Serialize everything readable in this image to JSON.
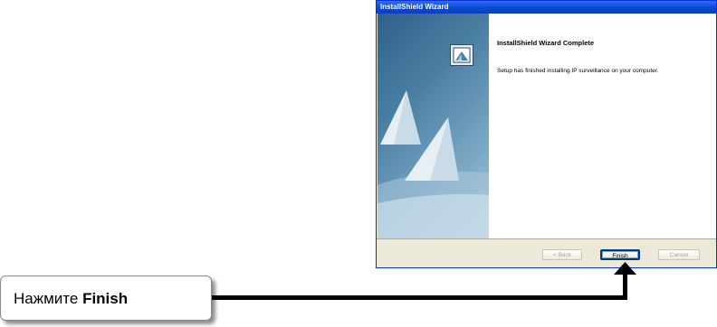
{
  "window": {
    "title": "InstallShield Wizard",
    "heading": "InstallShield Wizard Complete",
    "message": "Setup has finished installing IP surveillance on your computer."
  },
  "buttons": {
    "back": "< Back",
    "finish": "Finish",
    "cancel": "Cancel"
  },
  "callout": {
    "prefix": "Нажмите",
    "emphasis": "Finish"
  }
}
